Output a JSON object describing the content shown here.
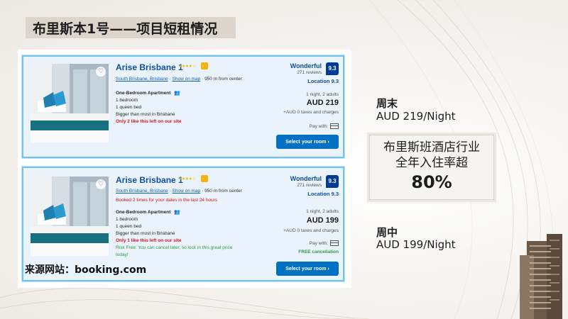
{
  "slide": {
    "title": "布里斯本1号——项目短租情况",
    "source_label": "来源网站：booking.com"
  },
  "listings": [
    {
      "hotel_name": "Arise Brisbane 1",
      "stars_icon": "star-rating-icon",
      "area_link": "South Brisbane, Brisbane",
      "map_link": "Show on map",
      "distance": "950 m from center",
      "booked_note": "",
      "room_type": "One-Bedroom Apartment",
      "room_line1": "1 bedroom",
      "room_line2": "1 queen bed",
      "room_line3": "Bigger than most in Brisbane",
      "scarcity": "Only 2 like this left on our site",
      "risk_free": "",
      "review_word": "Wonderful",
      "review_count": "271 reviews",
      "score": "9.3",
      "location_score": "Location 9.3",
      "nights": "1 night, 2 adults",
      "price": "AUD 219",
      "taxes": "+AUD 0 taxes and charges",
      "pay_with": "Pay with:",
      "free_cancellation": "",
      "select_label": "Select your room"
    },
    {
      "hotel_name": "Arise Brisbane 1",
      "stars_icon": "star-rating-icon",
      "area_link": "South Brisbane, Brisbane",
      "map_link": "Show on map",
      "distance": "950 m from center",
      "booked_note": "Booked 2 times for your dates in the last 24 hours",
      "room_type": "One-Bedroom Apartment",
      "room_line1": "1 bedroom",
      "room_line2": "1 queen bed",
      "room_line3": "Bigger than most in Brisbane",
      "scarcity": "Only 1 like this left on our site",
      "risk_free_1": "Risk Free: You can cancel later, so lock in this great price",
      "risk_free_2": "today!",
      "review_word": "Wonderful",
      "review_count": "271 reviews",
      "score": "9.3",
      "location_score": "Location 9.3",
      "nights": "1 night, 2 adults",
      "price": "AUD 199",
      "taxes": "+AUD 0 taxes and charges",
      "pay_with": "Pay with:",
      "free_cancellation": "FREE cancellation",
      "select_label": "Select your room"
    }
  ],
  "summary": {
    "weekend_label": "周末",
    "weekend_price": "AUD 219/Night",
    "occupancy_line1": "布里斯班酒店行业",
    "occupancy_line2": "全年入住率超",
    "occupancy_value": "80%",
    "weekday_label": "周中",
    "weekday_price": "AUD 199/Night"
  },
  "colors": {
    "title_bg": "#dcd5cc",
    "booking_blue": "#0071c2",
    "score_blue": "#003b95",
    "card_border": "#6fc3ef",
    "alert_red": "#d4111e",
    "success_green": "#2a9b3f"
  },
  "icons": {
    "favorite": "heart-icon",
    "guests": "people-icon",
    "payment": "credit-card-icon",
    "chevron": "chevron-right-icon"
  }
}
